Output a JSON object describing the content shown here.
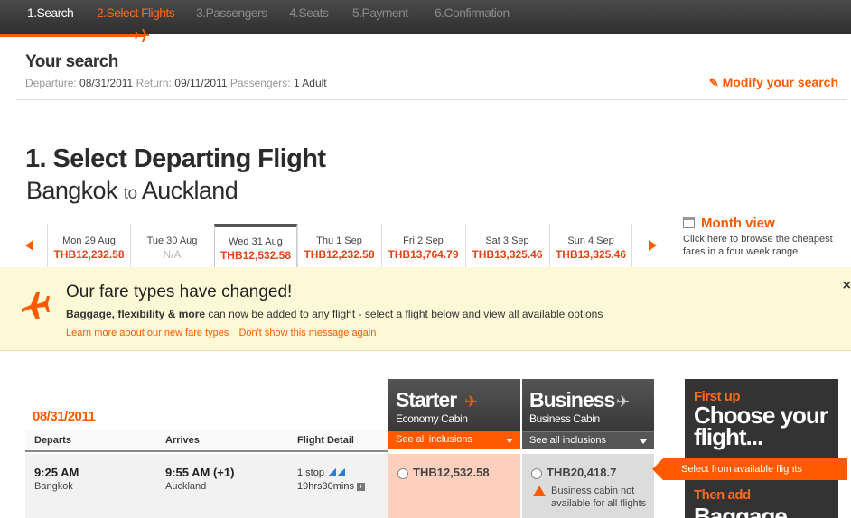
{
  "steps": [
    "1.Search",
    "2.Select Flights",
    "3.Passengers",
    "4.Seats",
    "5.Payment",
    "6.Confirmation"
  ],
  "search": {
    "title": "Your search",
    "departure_label": "Departure:",
    "departure": "08/31/2011",
    "return_label": "Return:",
    "return": "09/11/2011",
    "passengers_label": "Passengers:",
    "passengers": "1 Adult",
    "modify": "Modify your search"
  },
  "heading": {
    "title": "1. Select Departing Flight",
    "origin": "Bangkok",
    "to": "to",
    "destination": "Auckland"
  },
  "dates": [
    {
      "day": "Mon 29 Aug",
      "price": "THB12,232.58"
    },
    {
      "day": "Tue 30 Aug",
      "price": "N/A"
    },
    {
      "day": "Wed 31 Aug",
      "price": "THB12,532.58"
    },
    {
      "day": "Thu 1 Sep",
      "price": "THB12,232.58"
    },
    {
      "day": "Fri 2 Sep",
      "price": "THB13,764.79"
    },
    {
      "day": "Sat 3 Sep",
      "price": "THB13,325.46"
    },
    {
      "day": "Sun 4 Sep",
      "price": "THB13,325.46"
    }
  ],
  "month_view": {
    "title": "Month view",
    "desc": "Click here to browse the cheapest fares in a four week range"
  },
  "notice": {
    "title": "Our fare types have changed!",
    "body_bold": "Baggage, flexibility & more",
    "body": " can now be added to any flight - select a flight below and view all available options",
    "link1": "Learn more about our new fare types",
    "link2": "Don't show this message again",
    "close": "×"
  },
  "table": {
    "date": "08/31/2011",
    "col_departs": "Departs",
    "col_arrives": "Arrives",
    "col_detail": "Flight Detail"
  },
  "flight": {
    "depart_time": "9:25 AM",
    "depart_city": "Bangkok",
    "arrive_time": "9:55 AM (+1)",
    "arrive_city": "Auckland",
    "stops": "1 stop",
    "duration": "19hrs30mins"
  },
  "fares": {
    "starter": {
      "name": "Starter",
      "cabin": "Economy Cabin",
      "inclusions": "See all inclusions",
      "price": "THB12,532.58"
    },
    "business": {
      "name": "Business",
      "cabin": "Business Cabin",
      "inclusions": "See all inclusions",
      "price": "THB20,418.7",
      "warning": "Business cabin not available for all flights"
    }
  },
  "promo": {
    "line1": "First up",
    "line2": "Choose your flight...",
    "line3": "Then add",
    "line4": "Baggage",
    "callout": "Select from available flights"
  }
}
